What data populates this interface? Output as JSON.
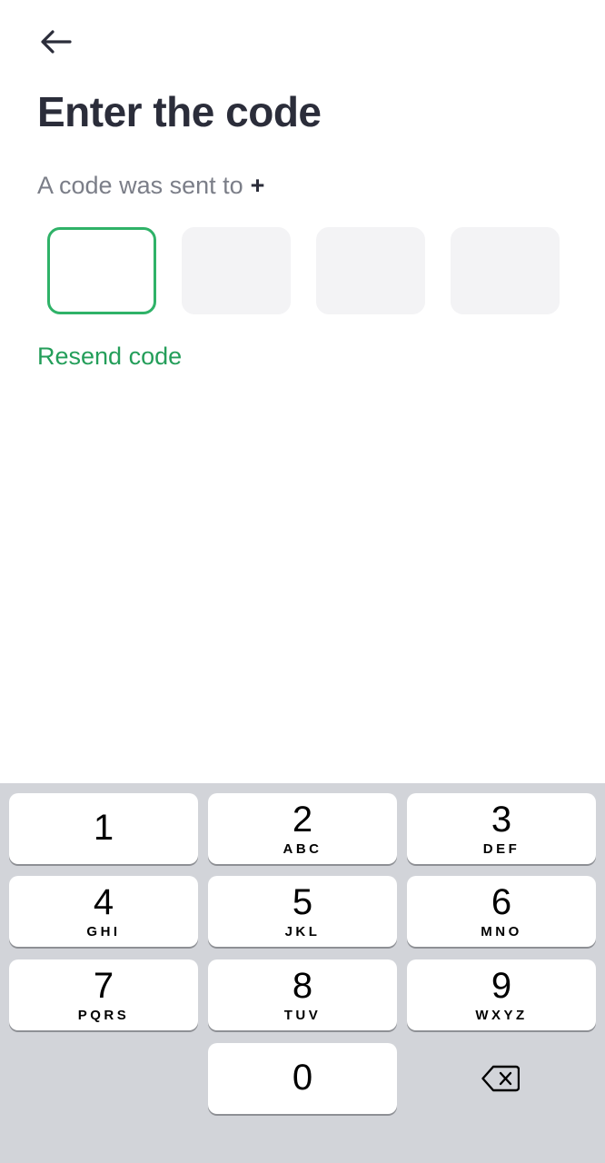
{
  "header": {
    "back_icon": "arrow-left-icon",
    "title": "Enter the code"
  },
  "message": {
    "text": "A code was sent to",
    "phone_visible": "+"
  },
  "code_input": {
    "length": 4,
    "active_index": 0,
    "digits": [
      "",
      "",
      "",
      ""
    ]
  },
  "resend": {
    "label": "Resend code"
  },
  "keypad": {
    "keys": [
      {
        "digit": "1",
        "letters": ""
      },
      {
        "digit": "2",
        "letters": "ABC"
      },
      {
        "digit": "3",
        "letters": "DEF"
      },
      {
        "digit": "4",
        "letters": "GHI"
      },
      {
        "digit": "5",
        "letters": "JKL"
      },
      {
        "digit": "6",
        "letters": "MNO"
      },
      {
        "digit": "7",
        "letters": "PQRS"
      },
      {
        "digit": "8",
        "letters": "TUV"
      },
      {
        "digit": "9",
        "letters": "WXYZ"
      },
      {
        "digit": "0",
        "letters": ""
      }
    ],
    "delete_icon": "backspace-icon"
  },
  "colors": {
    "accent": "#2fb268",
    "link": "#249e5a",
    "title": "#2b2d3a",
    "keypad_bg": "#d2d4d9"
  }
}
